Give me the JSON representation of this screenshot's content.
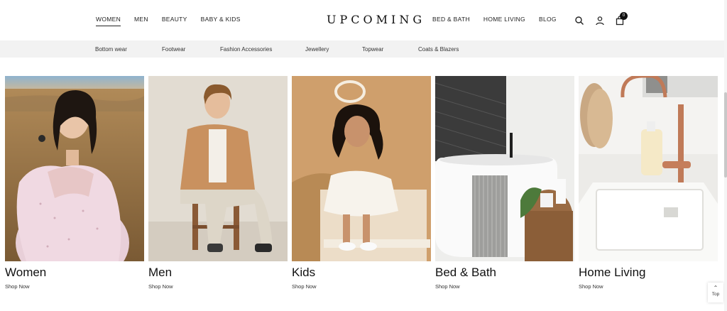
{
  "header": {
    "logo": "UPCOMING",
    "nav_left": [
      "WOMEN",
      "MEN",
      "BEAUTY",
      "BABY & KIDS"
    ],
    "nav_right": [
      "BED & BATH",
      "HOME LIVING",
      "BLOG"
    ],
    "active_nav": "WOMEN",
    "cart_count": "0",
    "icons": [
      "search-icon",
      "user-icon",
      "bag-icon"
    ]
  },
  "subnav": [
    "Bottom wear",
    "Footwear",
    "Fashion Accessories",
    "Jewellery",
    "Topwear",
    "Coats & Blazers"
  ],
  "categories": [
    {
      "title": "Women",
      "cta": "Shop Now"
    },
    {
      "title": "Men",
      "cta": "Shop Now"
    },
    {
      "title": "Kids",
      "cta": "Shop Now"
    },
    {
      "title": "Bed & Bath",
      "cta": "Shop Now"
    },
    {
      "title": "Home Living",
      "cta": "Shop Now"
    }
  ],
  "scroll_top": {
    "icon": "chevron-up-icon",
    "label": "Top"
  },
  "colors": {
    "accent": "#111111",
    "subbar_bg": "#f2f2f2"
  }
}
